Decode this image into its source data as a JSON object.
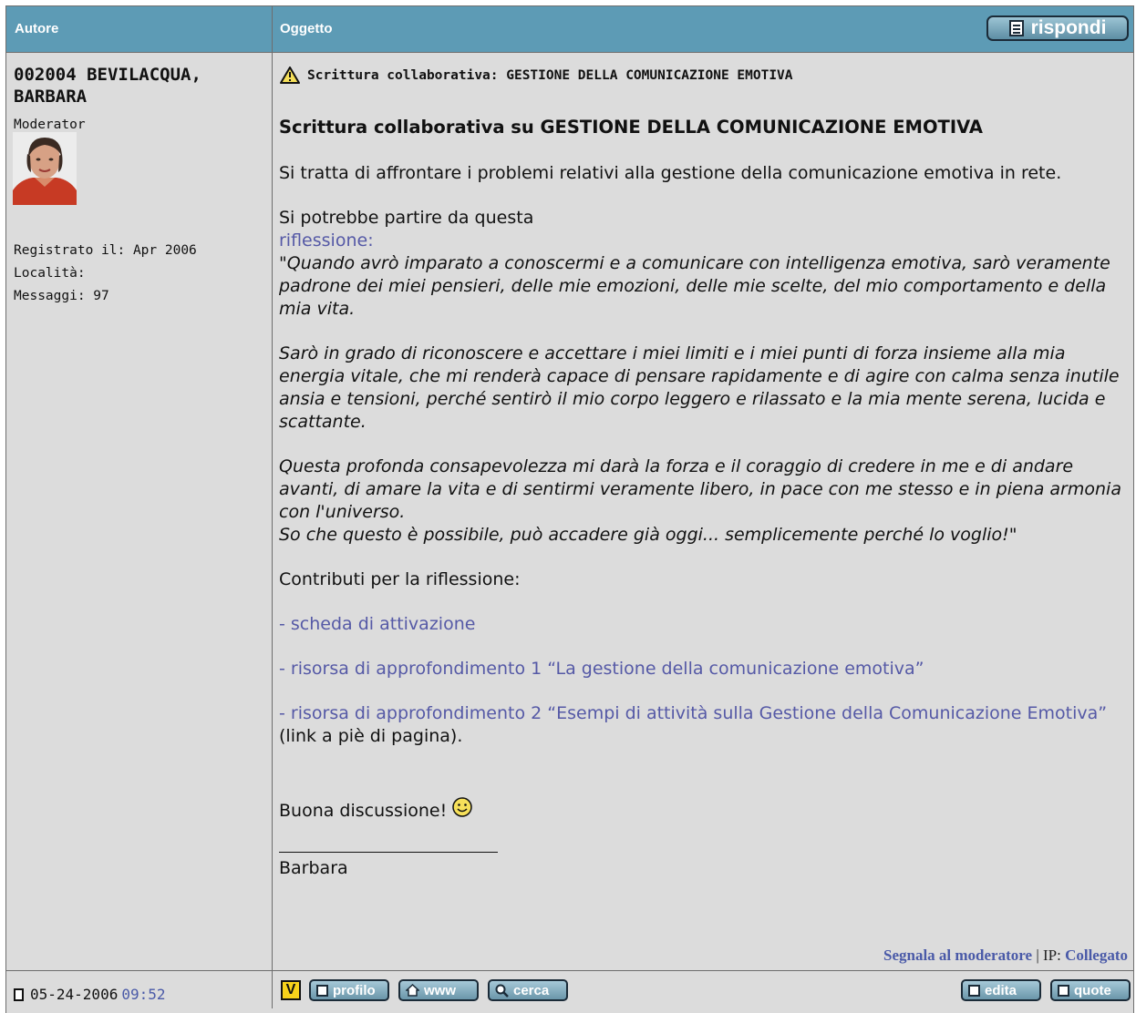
{
  "header": {
    "author_col": "Autore",
    "subject_col": "Oggetto",
    "reply_label": "rispondi"
  },
  "author": {
    "name": "002004 BEVILACQUA, BARBARA",
    "role": "Moderator",
    "registered": "Registrato il: Apr 2006",
    "location": "Località:",
    "posts": "Messaggi: 97"
  },
  "post": {
    "title": "Scrittura collaborativa: GESTIONE DELLA COMUNICAZIONE EMOTIVA",
    "heading": "Scrittura collaborativa su GESTIONE DELLA COMUNICAZIONE EMOTIVA",
    "intro": "Si tratta di affrontare i problemi relativi alla gestione della comunicazione emotiva in rete.",
    "start_text": "Si potrebbe partire da questa",
    "reflection_link": "riflessione",
    "reflection_colon": ":",
    "quote_p1": "\"Quando avrò imparato a conoscermi e a comunicare con intelligenza emotiva, sarò veramente padrone dei miei pensieri, delle mie emozioni, delle mie scelte, del mio comportamento e della mia vita.",
    "quote_p2": "Sarò in grado di riconoscere e accettare i miei limiti e i miei punti di forza insieme alla mia energia vitale, che mi renderà capace di pensare rapidamente e di agire con calma senza inutile ansia e tensioni, perché sentirò il mio corpo leggero e rilassato e la mia mente serena, lucida e scattante.",
    "quote_p3a": "Questa profonda consapevolezza mi darà la forza e il coraggio di credere in me e di andare avanti, di amare la vita e di sentirmi veramente libero, in pace con me stesso e in piena armonia con l'universo.",
    "quote_p3b": "So che questo è possibile, può accadere già oggi... semplicemente perché lo voglio!\"",
    "contributions_label": "Contributi per la riflessione:",
    "dash": "- ",
    "link1": "scheda di attivazione",
    "link2": "risorsa di approfondimento 1 “La gestione della comunicazione emotiva”",
    "link3": "risorsa di approfondimento 2 “Esempi di attività sulla Gestione della Comunicazione Emotiva”",
    "link3_suffix": " (link a piè di pagina).",
    "closing": "Buona discussione!",
    "signature": "Barbara",
    "report_link": "Segnala al moderatore",
    "ip_label": " | IP: ",
    "ip_value": "Collegato"
  },
  "footer": {
    "date": "05-24-2006",
    "time": "09:52",
    "v_label": "V",
    "profile": "profilo",
    "www": "www",
    "search": "cerca",
    "edit": "edita",
    "quote": "quote"
  }
}
